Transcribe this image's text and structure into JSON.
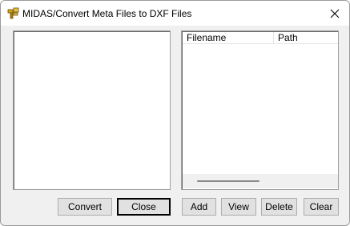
{
  "window": {
    "title": "MIDAS/Convert Meta Files to DXF Files",
    "app_icon": "midas-app-icon",
    "close_icon": "close-icon"
  },
  "file_list": {
    "columns": [
      "Filename",
      "Path"
    ],
    "rows": []
  },
  "buttons": {
    "convert": "Convert",
    "close": "Close",
    "add": "Add",
    "view": "View",
    "delete": "Delete",
    "clear": "Clear"
  }
}
